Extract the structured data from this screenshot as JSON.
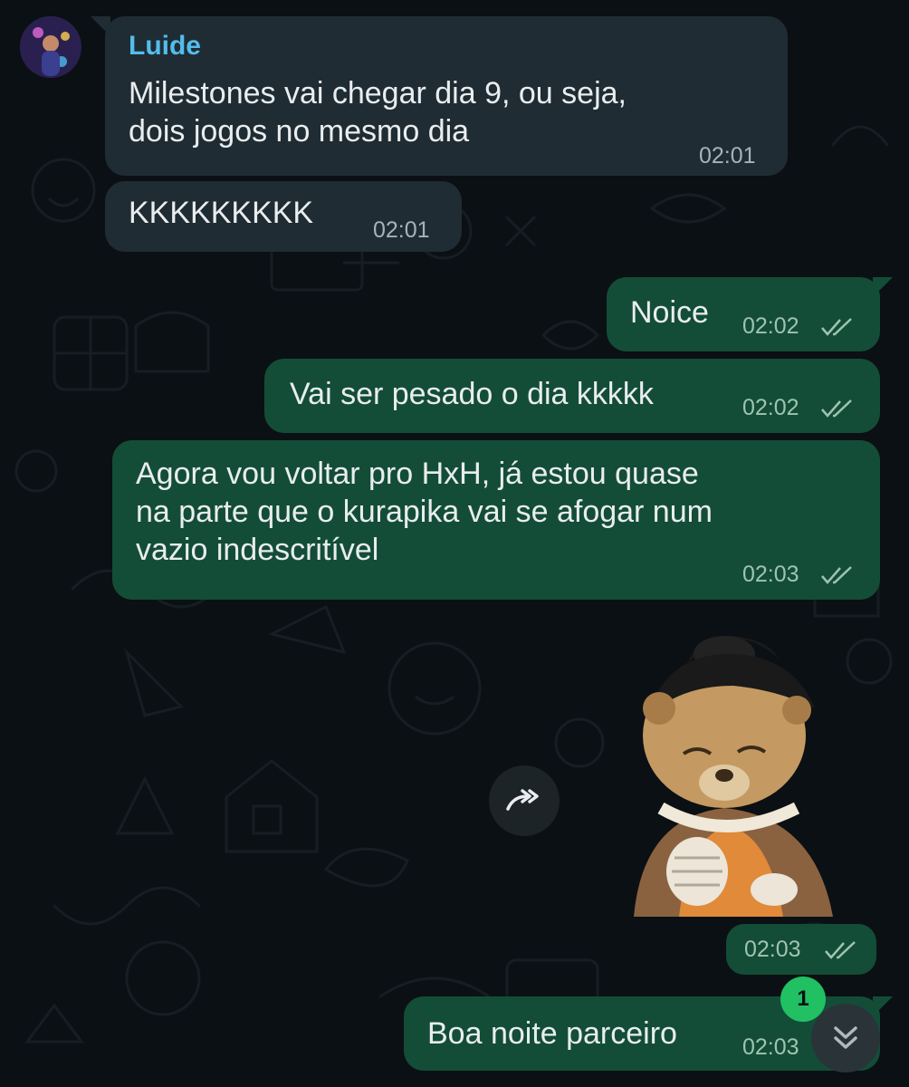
{
  "chat": {
    "contact_name": "Luide",
    "avatar_icon": "contact-avatar",
    "messages": [
      {
        "direction": "in",
        "text": "Milestones vai chegar dia 9, ou seja,\ndois jogos no mesmo dia",
        "time": "02:01"
      },
      {
        "direction": "in",
        "text": "KKKKKKKKK",
        "time": "02:01"
      },
      {
        "direction": "out",
        "text": "Noice",
        "time": "02:02",
        "status": "read"
      },
      {
        "direction": "out",
        "text": "Vai ser pesado o dia kkkkk",
        "time": "02:02",
        "status": "read"
      },
      {
        "direction": "out",
        "text": "Agora vou voltar pro HxH, já estou quase\nna parte que o kurapika vai se afogar num\nvazio indescritível",
        "time": "02:03",
        "status": "read"
      },
      {
        "direction": "out",
        "type": "sticker",
        "sticker_icon": "bear-character-sticker",
        "time": "02:03",
        "status": "read"
      },
      {
        "direction": "out",
        "text": "Boa noite parceiro",
        "time": "02:03",
        "status": "read"
      }
    ]
  },
  "controls": {
    "forward_icon": "forward-icon",
    "scroll_down_icon": "double-chevron-down-icon",
    "unread_count": "1"
  },
  "colors": {
    "background": "#0b1014",
    "incoming_bubble": "#1f2c33",
    "outgoing_bubble": "#134d37",
    "sender_name": "#53bdeb",
    "unread_badge": "#21c063"
  }
}
